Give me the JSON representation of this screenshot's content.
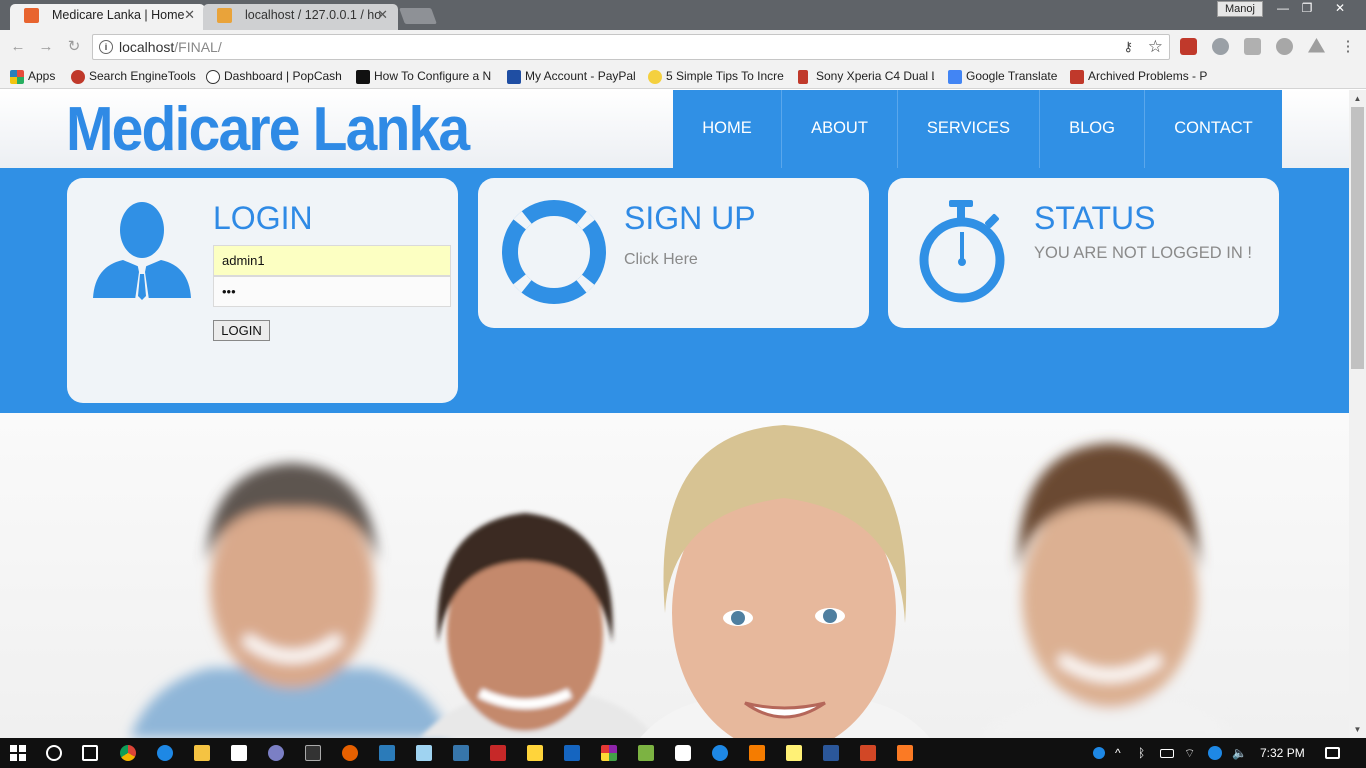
{
  "browser": {
    "tabs": [
      {
        "title": "Medicare Lanka | Home",
        "active": true
      },
      {
        "title": "localhost / 127.0.0.1 / ho",
        "active": false
      }
    ],
    "profile": "Manoj",
    "url_host": "localhost",
    "url_path": "/FINAL/",
    "bookmarks": [
      "Apps",
      "Search EngineTools",
      "Dashboard | PopCash",
      "How To Configure a N",
      "My Account - PayPal",
      "5 Simple Tips To Incre",
      "Sony Xperia C4 Dual L",
      "Google Translate",
      "Archived Problems - P"
    ]
  },
  "site": {
    "logo": "Medicare Lanka",
    "nav": [
      "HOME",
      "ABOUT",
      "SERVICES",
      "BLOG",
      "CONTACT"
    ],
    "login": {
      "title": "LOGIN",
      "username_value": "admin1",
      "password_value": "•••",
      "button": "LOGIN"
    },
    "signup": {
      "title": "SIGN UP",
      "subtitle": "Click Here"
    },
    "status": {
      "title": "STATUS",
      "message": "YOU ARE NOT LOGGED IN !"
    }
  },
  "taskbar": {
    "time": "7:32 PM"
  },
  "colors": {
    "brand_blue": "#3090e5",
    "card_bg": "#f0f4f8",
    "autofill_yellow": "#fcffc2"
  }
}
